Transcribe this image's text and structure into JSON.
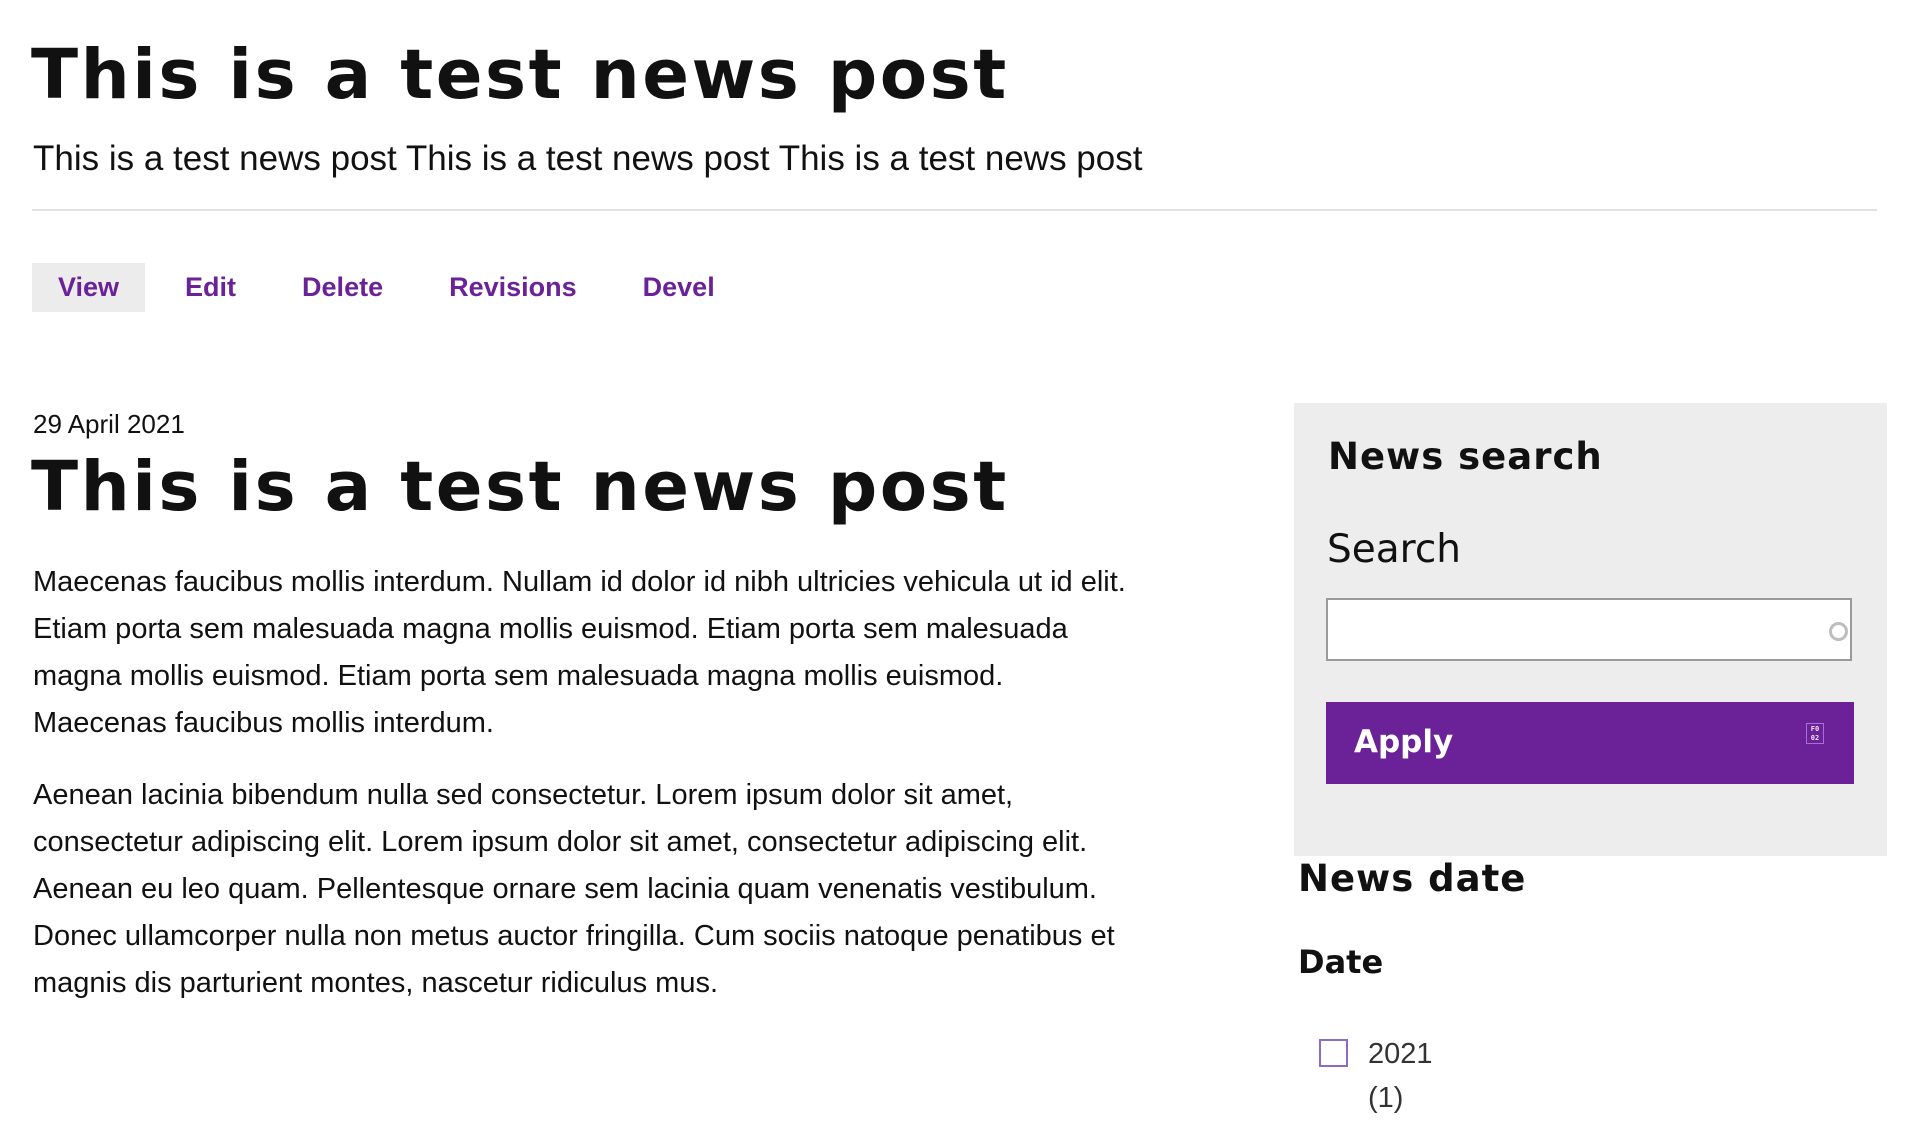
{
  "page": {
    "title": "This is a test news post",
    "subtitle": "This is a test news post This is a test news post This is a test news post"
  },
  "tabs": [
    {
      "label": "View",
      "active": true
    },
    {
      "label": "Edit",
      "active": false
    },
    {
      "label": "Delete",
      "active": false
    },
    {
      "label": "Revisions",
      "active": false
    },
    {
      "label": "Devel",
      "active": false
    }
  ],
  "article": {
    "date": "29 April 2021",
    "title": "This is a test news post",
    "paragraphs": [
      {
        "lines": [
          "Maecenas faucibus mollis interdum. Nullam id dolor id nibh ultricies vehicula ut id elit.",
          "Etiam porta sem malesuada magna mollis euismod. Etiam porta sem malesuada",
          "magna mollis euismod. Etiam porta sem malesuada magna mollis euismod.",
          "Maecenas faucibus mollis interdum."
        ]
      },
      {
        "lines": [
          "Aenean lacinia bibendum nulla sed consectetur. Lorem ipsum dolor sit amet,",
          "consectetur adipiscing elit. Lorem ipsum dolor sit amet, consectetur adipiscing elit.",
          "Aenean eu leo quam. Pellentesque ornare sem lacinia quam venenatis vestibulum.",
          "Donec ullamcorper nulla non metus auctor fringilla. Cum sociis natoque penatibus et",
          "magnis dis parturient montes, nascetur ridiculus mus."
        ]
      }
    ]
  },
  "sidebar": {
    "news_search": {
      "heading": "News search",
      "search_label": "Search",
      "search_value": "",
      "search_icon": "circle-search-icon",
      "apply_label": "Apply",
      "apply_glyph": "F0 02"
    },
    "news_date": {
      "heading": "News date",
      "date_label": "Date",
      "options": [
        {
          "label": "2021",
          "count": "(1)",
          "checked": false
        }
      ]
    }
  },
  "colors": {
    "accent": "#6b2198",
    "tab_active_bg": "#ececec",
    "sidebar_bg": "#ededed",
    "text": "#111111"
  }
}
